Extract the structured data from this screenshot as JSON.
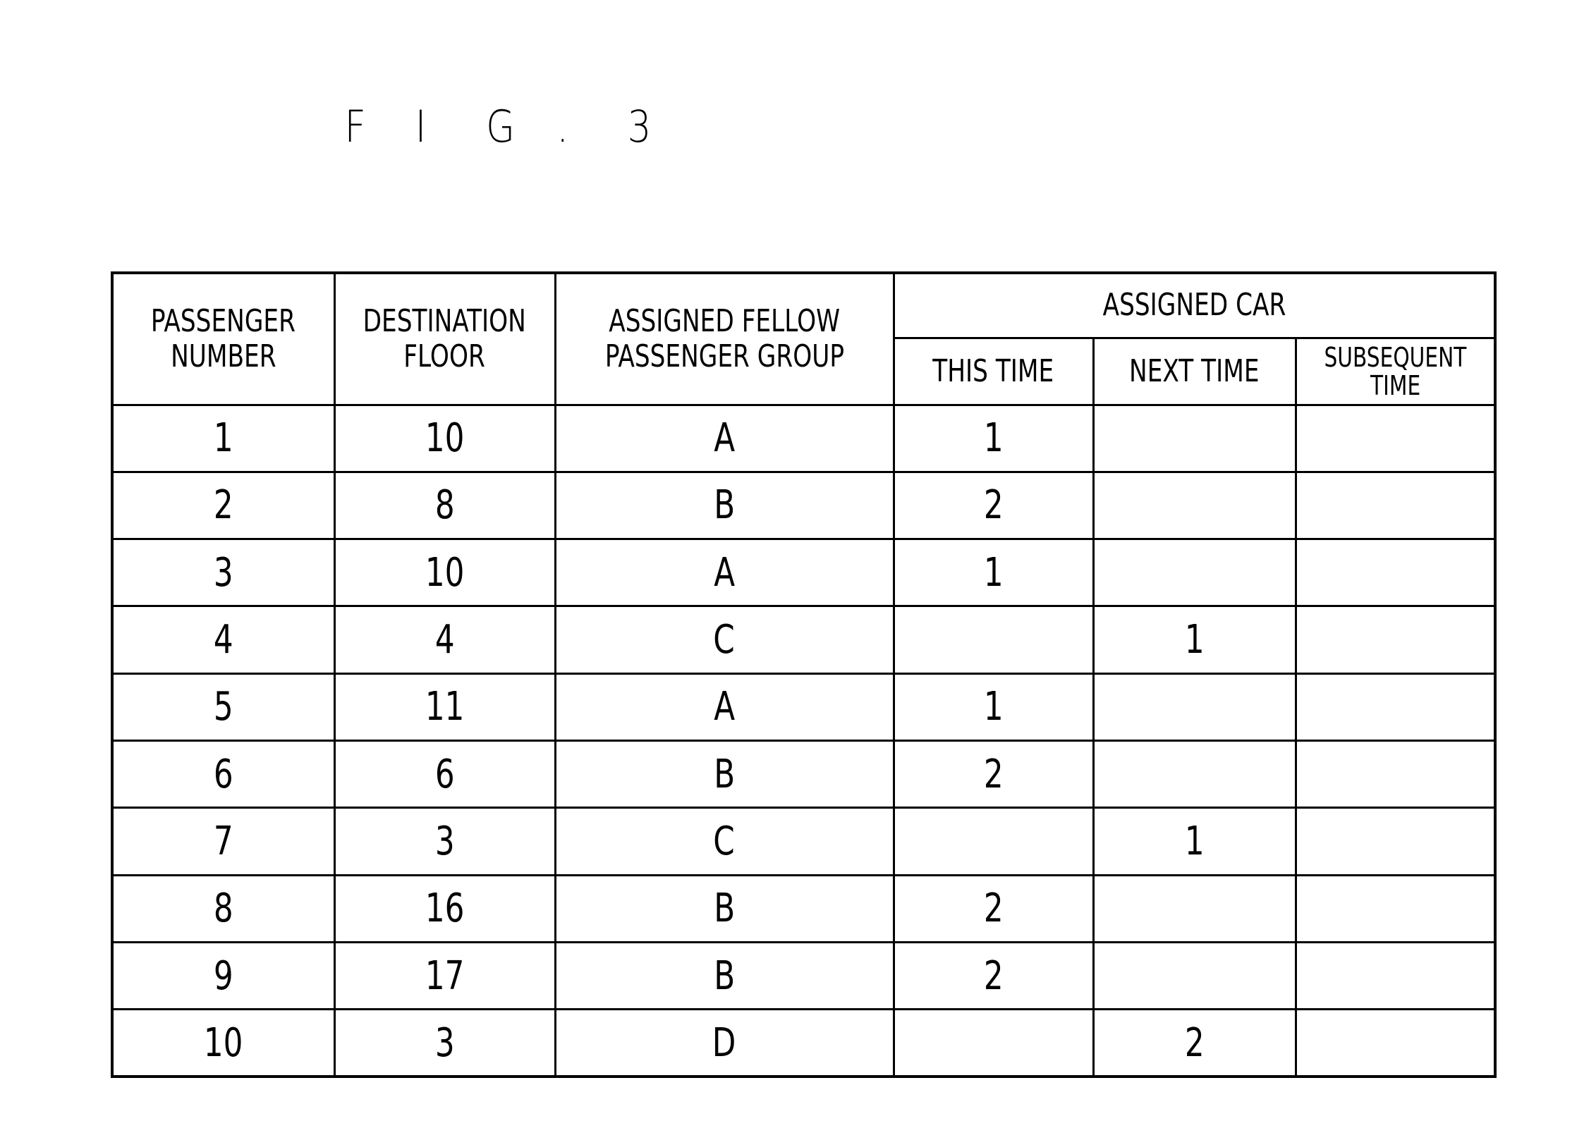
{
  "figure": {
    "title_chars": [
      "F",
      "I",
      "G",
      ".",
      "3"
    ],
    "title": "FIG. 3"
  },
  "table": {
    "headers": {
      "passenger_number": [
        "PASSENGER",
        "NUMBER"
      ],
      "destination_floor": [
        "DESTINATION",
        "FLOOR"
      ],
      "assigned_group": [
        "ASSIGNED FELLOW",
        "PASSENGER GROUP"
      ],
      "assigned_car": "ASSIGNED CAR",
      "this_time": "THIS TIME",
      "next_time": "NEXT TIME",
      "subsequent_time": [
        "SUBSEQUENT",
        "TIME"
      ]
    },
    "rows": [
      {
        "passenger": "1",
        "floor": "10",
        "group": "A",
        "this_time": "1",
        "next_time": "",
        "subsequent": ""
      },
      {
        "passenger": "2",
        "floor": "8",
        "group": "B",
        "this_time": "2",
        "next_time": "",
        "subsequent": ""
      },
      {
        "passenger": "3",
        "floor": "10",
        "group": "A",
        "this_time": "1",
        "next_time": "",
        "subsequent": ""
      },
      {
        "passenger": "4",
        "floor": "4",
        "group": "C",
        "this_time": "",
        "next_time": "1",
        "subsequent": ""
      },
      {
        "passenger": "5",
        "floor": "11",
        "group": "A",
        "this_time": "1",
        "next_time": "",
        "subsequent": ""
      },
      {
        "passenger": "6",
        "floor": "6",
        "group": "B",
        "this_time": "2",
        "next_time": "",
        "subsequent": ""
      },
      {
        "passenger": "7",
        "floor": "3",
        "group": "C",
        "this_time": "",
        "next_time": "1",
        "subsequent": ""
      },
      {
        "passenger": "8",
        "floor": "16",
        "group": "B",
        "this_time": "2",
        "next_time": "",
        "subsequent": ""
      },
      {
        "passenger": "9",
        "floor": "17",
        "group": "B",
        "this_time": "2",
        "next_time": "",
        "subsequent": ""
      },
      {
        "passenger": "10",
        "floor": "3",
        "group": "D",
        "this_time": "",
        "next_time": "2",
        "subsequent": ""
      }
    ]
  }
}
